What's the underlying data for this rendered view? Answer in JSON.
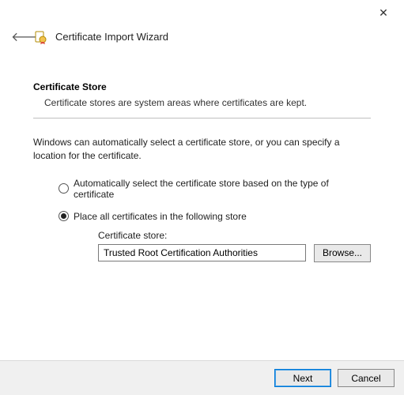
{
  "window": {
    "close_glyph": "✕"
  },
  "header": {
    "back_glyph": "🡐",
    "title": "Certificate Import Wizard"
  },
  "section": {
    "title": "Certificate Store",
    "description": "Certificate stores are system areas where certificates are kept."
  },
  "instructions": "Windows can automatically select a certificate store, or you can specify a location for the certificate.",
  "options": {
    "auto_label": "Automatically select the certificate store based on the type of certificate",
    "place_label": "Place all certificates in the following store",
    "selected": "place"
  },
  "store": {
    "label": "Certificate store:",
    "value": "Trusted Root Certification Authorities",
    "browse_label": "Browse..."
  },
  "footer": {
    "next_label": "Next",
    "cancel_label": "Cancel"
  }
}
